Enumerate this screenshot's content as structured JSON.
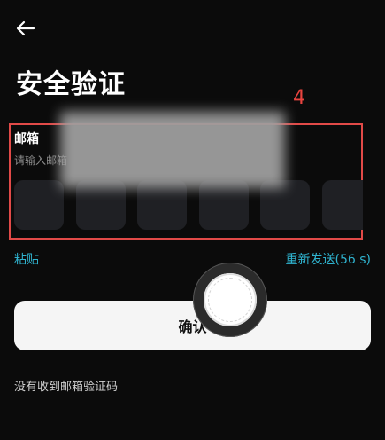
{
  "header": {
    "title": "安全验证",
    "back_icon": "arrow-left-icon"
  },
  "annotation": {
    "number": "4",
    "color": "#e24a48"
  },
  "form": {
    "email_label": "邮箱",
    "email_placeholder": "请输入邮箱",
    "otp_boxes": 6
  },
  "links": {
    "paste": "粘贴",
    "resend": "重新发送(56 s)",
    "no_code": "没有收到邮箱验证码",
    "accent_color": "#2fb3cf"
  },
  "confirm_button": {
    "label": "确认"
  },
  "overlay": {
    "touch_icon": "assistive-touch-icon"
  }
}
